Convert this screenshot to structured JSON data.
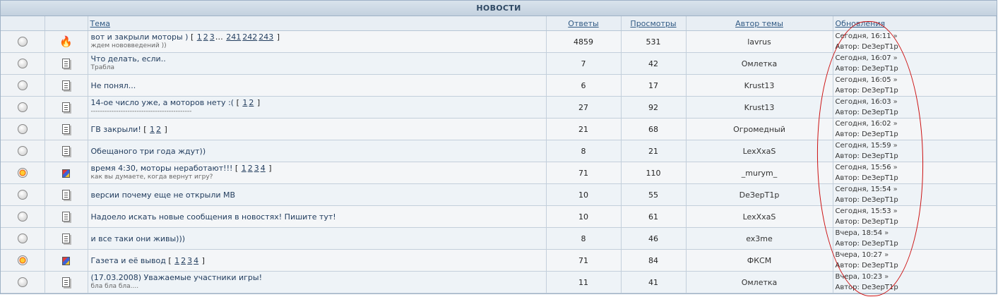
{
  "forum_title": "НОВОСТИ",
  "columns": {
    "topic": "Тема",
    "replies": "Ответы",
    "views": "Просмотры",
    "author": "Автор темы",
    "updates": "Обновления"
  },
  "labels": {
    "author_prefix": "Автор:"
  },
  "topics": [
    {
      "status": "radio",
      "icon": "fire-icon",
      "title": "вот и закрыли моторы )",
      "desc": "ждем нововведений ))",
      "pages": [
        "1",
        "2",
        "3",
        "…",
        "241",
        "242",
        "243"
      ],
      "replies": "4859",
      "views": "531",
      "author": "lavrus",
      "last_time": "Сегодня, 16:11",
      "last_author": "DeЗерТ1р"
    },
    {
      "status": "radio",
      "icon": "doc-icon",
      "title": "Что делать, если..",
      "desc": "Трабла",
      "pages": [],
      "replies": "7",
      "views": "42",
      "author": "Омлетка",
      "last_time": "Сегодня, 16:07",
      "last_author": "DeЗерТ1р"
    },
    {
      "status": "radio",
      "icon": "doc-icon",
      "title": "Не понял...",
      "desc": "",
      "pages": [],
      "replies": "6",
      "views": "17",
      "author": "Krust13",
      "last_time": "Сегодня, 16:05",
      "last_author": "DeЗерТ1р"
    },
    {
      "status": "radio",
      "icon": "doc-icon",
      "title": "14-ое число уже, а моторов нету :(",
      "desc": "--------------------------------------------",
      "pages": [
        "1",
        "2"
      ],
      "replies": "27",
      "views": "92",
      "author": "Krust13",
      "last_time": "Сегодня, 16:03",
      "last_author": "DeЗерТ1р"
    },
    {
      "status": "radio",
      "icon": "doc-icon",
      "title": "ГВ закрыли!",
      "desc": "",
      "pages": [
        "1",
        "2"
      ],
      "replies": "21",
      "views": "68",
      "author": "Огромедный",
      "last_time": "Сегодня, 16:02",
      "last_author": "DeЗерТ1р"
    },
    {
      "status": "radio",
      "icon": "doc-icon",
      "title": "Обещаного три года ждут))",
      "desc": "",
      "pages": [],
      "replies": "8",
      "views": "21",
      "author": "LexXxaS",
      "last_time": "Сегодня, 15:59",
      "last_author": "DeЗерТ1р"
    },
    {
      "status": "hot",
      "icon": "cube-icon",
      "title": "время 4:30, моторы неработают!!!",
      "desc": "как вы думаете, когда вернут игру?",
      "pages": [
        "1",
        "2",
        "3",
        "4"
      ],
      "replies": "71",
      "views": "110",
      "author": "_murym_",
      "last_time": "Сегодня, 15:56",
      "last_author": "DeЗерТ1р"
    },
    {
      "status": "radio",
      "icon": "doc-icon",
      "title": "версии почему еще не открыли МВ",
      "desc": "",
      "pages": [],
      "replies": "10",
      "views": "55",
      "author": "DeЗерТ1р",
      "last_time": "Сегодня, 15:54",
      "last_author": "DeЗерТ1р"
    },
    {
      "status": "radio",
      "icon": "doc-icon",
      "title": "Надоело искать новые сообщения в новостях! Пишите тут!",
      "desc": "",
      "pages": [],
      "replies": "10",
      "views": "61",
      "author": "LexXxaS",
      "last_time": "Сегодня, 15:53",
      "last_author": "DeЗерТ1р"
    },
    {
      "status": "radio",
      "icon": "doc-icon",
      "title": "и все таки они живы)))",
      "desc": "",
      "pages": [],
      "replies": "8",
      "views": "46",
      "author": "ex3me",
      "last_time": "Вчера, 18:54",
      "last_author": "DeЗерТ1р"
    },
    {
      "status": "hot",
      "icon": "cube-icon",
      "title": "Газета и её вывод",
      "desc": "",
      "pages": [
        "1",
        "2",
        "3",
        "4"
      ],
      "replies": "71",
      "views": "84",
      "author": "ФКСМ",
      "last_time": "Вчера, 10:27",
      "last_author": "DeЗерТ1р"
    },
    {
      "status": "radio",
      "icon": "doc-icon",
      "title": "(17.03.2008) Уважаемые участники игры!",
      "desc": "бла бла бла....",
      "pages": [],
      "replies": "11",
      "views": "41",
      "author": "Омлетка",
      "last_time": "Вчера, 10:23",
      "last_author": "DeЗерТ1р"
    }
  ]
}
